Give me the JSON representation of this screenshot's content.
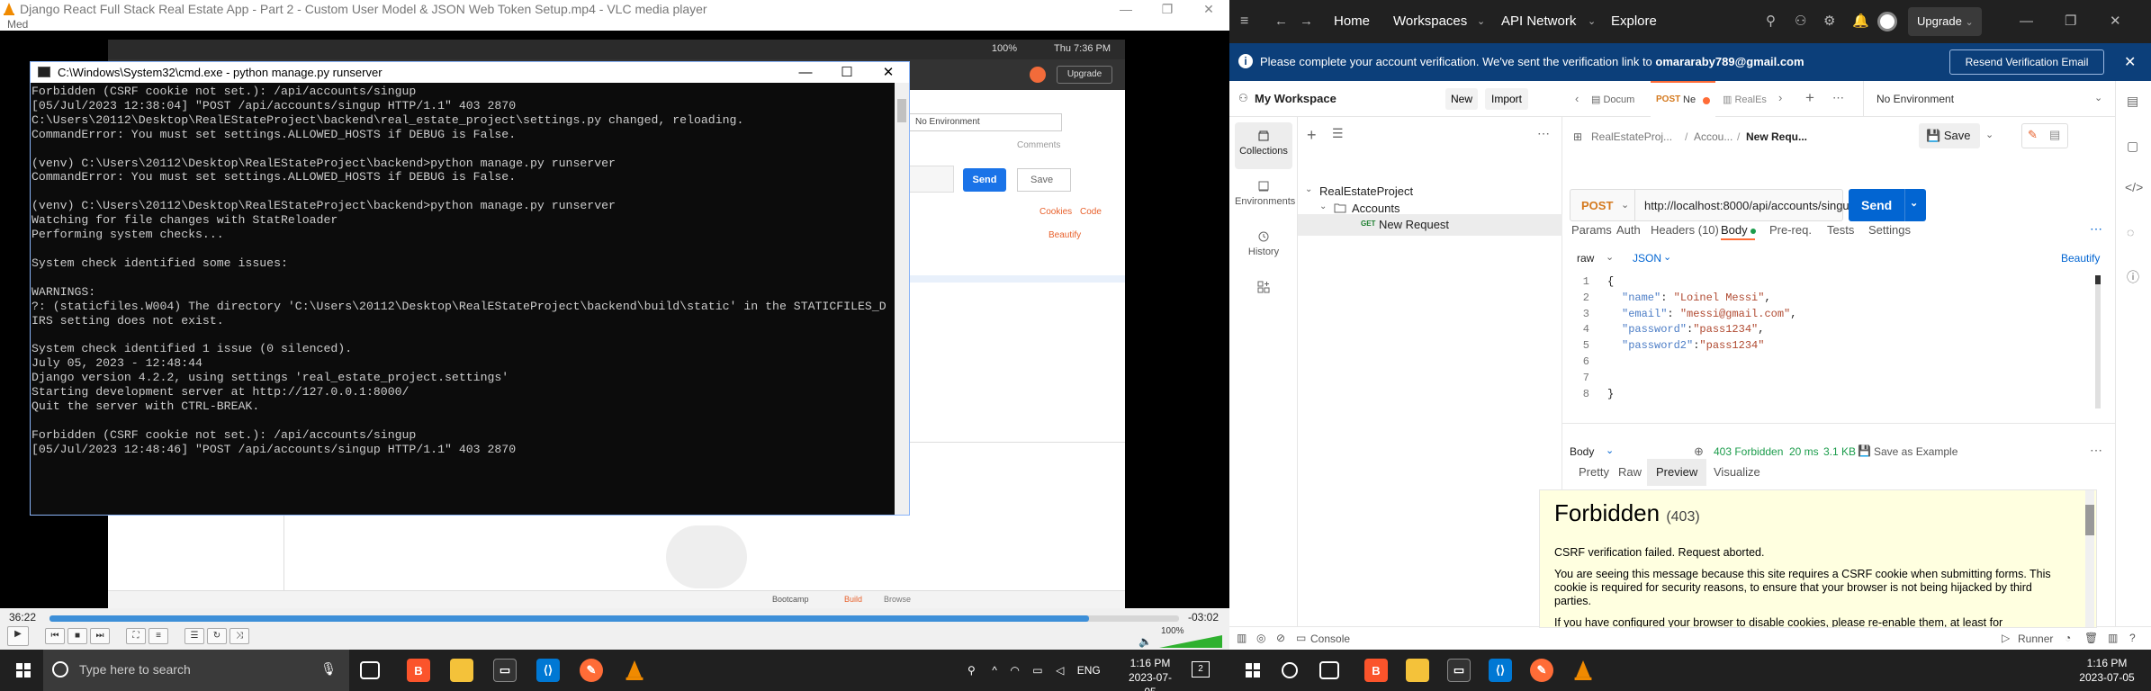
{
  "vlc": {
    "title": "Django React Full Stack Real Estate App - Part 2 - Custom User Model & JSON Web Token Setup.mp4 - VLC media player",
    "menu_label": "Med",
    "time_elapsed": "36:22",
    "time_remaining": "-03:02",
    "progress_percent": 92,
    "volume_label": "100%",
    "inner_app": {
      "no_environment": "No Environment",
      "send": "Send",
      "save": "Save",
      "comments": "Comments",
      "cookies": "Cookies",
      "code": "Code",
      "beautify": "Beautify",
      "upgrade": "Upgrade",
      "status_time": "Thu 7:36 PM",
      "status_battery": "100%",
      "bootcamp": "Bootcamp",
      "build": "Build",
      "browse": "Browse"
    }
  },
  "cmd": {
    "title": "C:\\Windows\\System32\\cmd.exe - python  manage.py runserver",
    "lines": [
      "Forbidden (CSRF cookie not set.): /api/accounts/singup",
      "[05/Jul/2023 12:38:04] \"POST /api/accounts/singup HTTP/1.1\" 403 2870",
      "C:\\Users\\20112\\Desktop\\RealEStateProject\\backend\\real_estate_project\\settings.py changed, reloading.",
      "CommandError: You must set settings.ALLOWED_HOSTS if DEBUG is False.",
      "",
      "(venv) C:\\Users\\20112\\Desktop\\RealEStateProject\\backend>python manage.py runserver",
      "CommandError: You must set settings.ALLOWED_HOSTS if DEBUG is False.",
      "",
      "(venv) C:\\Users\\20112\\Desktop\\RealEStateProject\\backend>python manage.py runserver",
      "Watching for file changes with StatReloader",
      "Performing system checks...",
      "",
      "System check identified some issues:",
      "",
      "WARNINGS:",
      "?: (staticfiles.W004) The directory 'C:\\Users\\20112\\Desktop\\RealEStateProject\\backend\\build\\static' in the STATICFILES_D",
      "IRS setting does not exist.",
      "",
      "System check identified 1 issue (0 silenced).",
      "July 05, 2023 - 12:48:44",
      "Django version 4.2.2, using settings 'real_estate_project.settings'",
      "Starting development server at http://127.0.0.1:8000/",
      "Quit the server with CTRL-BREAK.",
      "",
      "Forbidden (CSRF cookie not set.): /api/accounts/singup",
      "[05/Jul/2023 12:48:46] \"POST /api/accounts/singup HTTP/1.1\" 403 2870"
    ]
  },
  "taskbar_left": {
    "search_placeholder": "Type here to search",
    "lang": "ENG",
    "time": "1:16 PM",
    "date": "2023-07-05",
    "notif_count": "2"
  },
  "taskbar_right": {
    "time": "1:16 PM",
    "date": "2023-07-05"
  },
  "postman": {
    "nav": {
      "home": "Home",
      "workspaces": "Workspaces",
      "api_network": "API Network",
      "explore": "Explore",
      "upgrade": "Upgrade"
    },
    "banner": {
      "text_prefix": "Please complete your account verification. We've sent the verification link to ",
      "email": "omararaby789@gmail.com",
      "resend": "Resend Verification Email"
    },
    "workspace": {
      "name": "My Workspace",
      "new": "New",
      "import": "Import"
    },
    "sidebar": [
      {
        "label": "Collections"
      },
      {
        "label": "Environments"
      },
      {
        "label": "History"
      }
    ],
    "tree": {
      "collection": "RealEstateProject",
      "folder": "Accounts",
      "request_method": "GET",
      "request_name": "New Request"
    },
    "tabs": {
      "tab1": "Docum",
      "tab2_method": "POST",
      "tab2_name": "Ne",
      "tab3": "RealEs",
      "environment": "No Environment"
    },
    "breadcrumb": {
      "collection": "RealEstateProj...",
      "folder": "Accou...",
      "request": "New Requ..."
    },
    "save": "Save",
    "request": {
      "method": "POST",
      "url": "http://localhost:8000/api/accounts/singup",
      "send": "Send"
    },
    "req_tabs": {
      "params": "Params",
      "auth": "Auth",
      "headers": "Headers (10)",
      "body": "Body",
      "prereq": "Pre-req.",
      "tests": "Tests",
      "settings": "Settings"
    },
    "body_mode": "raw",
    "body_lang": "JSON",
    "beautify": "Beautify",
    "code_lines": [
      {
        "n": "1",
        "text": "{"
      },
      {
        "n": "2",
        "key": "\"name\"",
        "sep": ": ",
        "val": "\"Loinel Messi\"",
        "end": ","
      },
      {
        "n": "3",
        "key": "\"email\"",
        "sep": ": ",
        "val": "\"messi@gmail.com\"",
        "end": ","
      },
      {
        "n": "4",
        "key": "\"password\"",
        "sep": ":",
        "val": "\"pass1234\"",
        "end": ","
      },
      {
        "n": "5",
        "key": "\"password2\"",
        "sep": ":",
        "val": "\"pass1234\"",
        "end": ""
      },
      {
        "n": "6",
        "text": ""
      },
      {
        "n": "7",
        "text": ""
      },
      {
        "n": "8",
        "text": "}"
      }
    ],
    "response": {
      "label": "Body",
      "status": "403 Forbidden",
      "time": "20 ms",
      "size": "3.1 KB",
      "save_example": "Save as Example",
      "tabs": [
        "Pretty",
        "Raw",
        "Preview",
        "Visualize"
      ],
      "active_tab": "Preview",
      "heading": "Forbidden",
      "code": "(403)",
      "p1": "CSRF verification failed. Request aborted.",
      "p2": "You are seeing this message because this site requires a CSRF cookie when submitting forms. This cookie is required for security reasons, to ensure that your browser is not being hijacked by third parties.",
      "p3": "If you have configured your browser to disable cookies, please re-enable them, at least for"
    },
    "status_bar": {
      "console": "Console",
      "runner": "Runner"
    }
  }
}
